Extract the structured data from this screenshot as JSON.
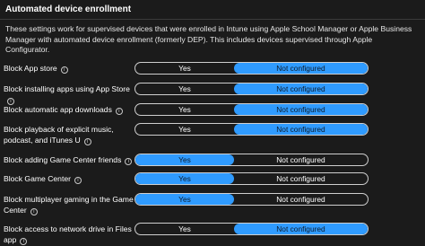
{
  "section": {
    "title": "Automated device enrollment",
    "description": "These settings work for supervised devices that were enrolled in Intune using Apple School Manager or Apple Business Manager with automated device enrollment (formerly DEP). This includes devices supervised through Apple Configurator."
  },
  "info_icon_glyph": "i",
  "settings": [
    {
      "label": "Block App store",
      "yes": "Yes",
      "not_configured": "Not configured",
      "selected": "not_configured"
    },
    {
      "label": "Block installing apps using App Store",
      "yes": "Yes",
      "not_configured": "Not configured",
      "selected": "not_configured"
    },
    {
      "label": "Block automatic app downloads",
      "yes": "Yes",
      "not_configured": "Not configured",
      "selected": "not_configured"
    },
    {
      "label": "Block playback of explicit music, podcast, and iTunes U",
      "yes": "Yes",
      "not_configured": "Not configured",
      "selected": "not_configured"
    },
    {
      "label": "Block adding Game Center friends",
      "yes": "Yes",
      "not_configured": "Not configured",
      "selected": "yes"
    },
    {
      "label": "Block Game Center",
      "yes": "Yes",
      "not_configured": "Not configured",
      "selected": "yes"
    },
    {
      "label": "Block multiplayer gaming in the Game Center",
      "yes": "Yes",
      "not_configured": "Not configured",
      "selected": "yes"
    },
    {
      "label": "Block access to network drive in Files app",
      "yes": "Yes",
      "not_configured": "Not configured",
      "selected": "not_configured"
    }
  ],
  "colors": {
    "background": "#1b1b1b",
    "accent": "#2f9bff",
    "toggle_border": "#cfcfcf"
  }
}
